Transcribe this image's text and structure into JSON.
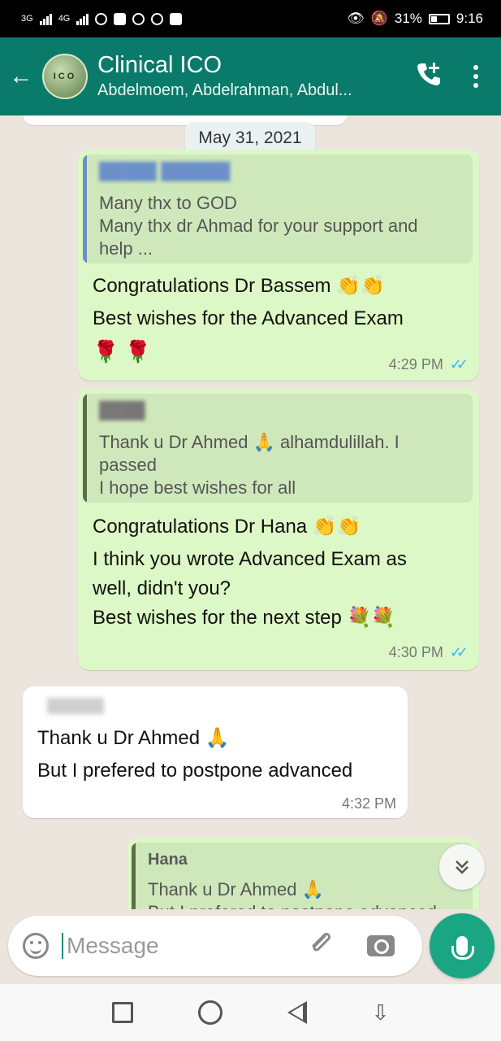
{
  "status_bar": {
    "network_left": "3G",
    "network_right": "4G",
    "battery": "31%",
    "time": "9:16"
  },
  "header": {
    "title": "Clinical ICO",
    "subtitle": "Abdelmoem, Abdelrahman, Abdul...",
    "avatar_text": "ICO"
  },
  "chat": {
    "date_chip": "May 31, 2021",
    "messages": [
      {
        "direction": "outgoing",
        "quote": {
          "lines": [
            "Many thx to GOD",
            "Many thx dr Ahmad for your support and",
            "help ..."
          ]
        },
        "lines": [
          "Congratulations Dr Bassem 👏👏",
          "Best wishes for the Advanced Exam",
          "🌹 🌹"
        ],
        "time": "4:29 PM",
        "status": "read"
      },
      {
        "direction": "outgoing",
        "quote": {
          "lines": [
            "Thank u Dr Ahmed 🙏 alhamdulillah. I",
            "passed",
            "I hope best wishes for all"
          ]
        },
        "lines": [
          "Congratulations Dr Hana 👏👏",
          "I think you wrote Advanced Exam as",
          "well, didn't you?",
          "Best wishes for the next step 💐💐"
        ],
        "time": "4:30 PM",
        "status": "read"
      },
      {
        "direction": "incoming",
        "lines": [
          "Thank u Dr Ahmed 🙏",
          "But I prefered to postpone advanced"
        ],
        "time": "4:32 PM"
      },
      {
        "direction": "outgoing",
        "quote": {
          "name": "Hana",
          "lines": [
            "Thank u Dr Ahmed 🙏",
            "But I prefered to postpone advanced"
          ]
        }
      }
    ]
  },
  "input": {
    "placeholder": "Message"
  },
  "colors": {
    "header": "#0a7a6a",
    "outgoing_bubble": "#dcf8c6",
    "incoming_bubble": "#ffffff",
    "read_ticks": "#34b7f1",
    "quote_bar_blue": "#6b8fc8",
    "quote_bar_green": "#5a6e4c",
    "mic_button": "#1aa583"
  },
  "icons": {
    "back": "arrow-left-icon",
    "add_call": "add-call-icon",
    "menu": "more-vertical-icon",
    "emoji": "emoji-icon",
    "attach": "paperclip-icon",
    "camera": "camera-icon",
    "mic": "mic-icon",
    "scroll_down": "chevron-double-down-icon"
  }
}
